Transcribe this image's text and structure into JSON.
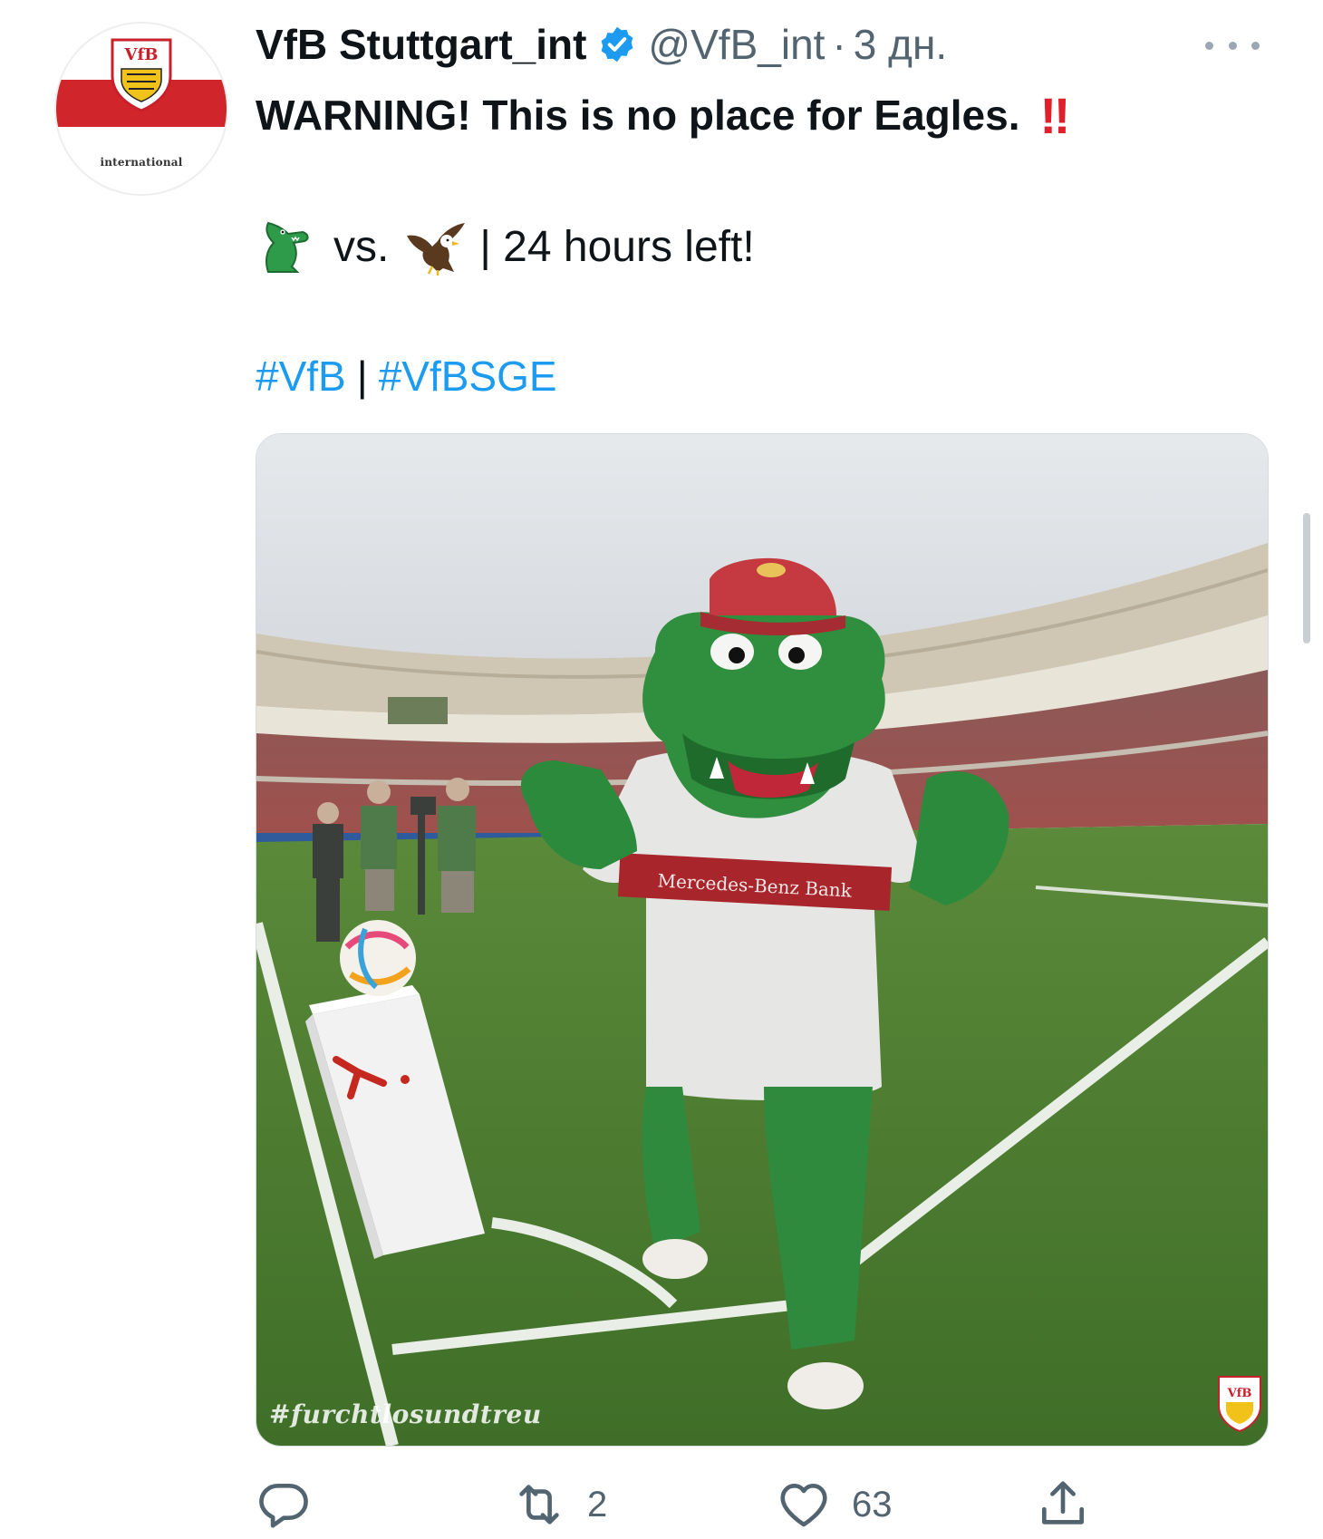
{
  "tweet": {
    "author_name": "VfB Stuttgart_int",
    "handle": "@VfB_int",
    "separator": "·",
    "timestamp": "3 дн.",
    "avatar_caption": "international",
    "line1": "WARNING! This is no place for Eagles.",
    "line1_emoji": "‼",
    "line2_vs": "vs.",
    "line2_rest": "| 24 hours left!",
    "hashtags": [
      "#VfB",
      "#VfBSGE"
    ],
    "hashtag_separator": "|",
    "media": {
      "watermark": "#furchtlosundtreu",
      "shirt_sponsor": "Mercedes-Benz Bank"
    },
    "actions": {
      "reply_count": "",
      "retweet_count": "2",
      "like_count": "63"
    }
  },
  "icons": {
    "verified": "verified-badge-icon",
    "more": "more-options-icon",
    "reply": "reply-icon",
    "retweet": "retweet-icon",
    "like": "heart-icon",
    "share": "share-icon",
    "emoji1": "crocodile-emoji",
    "emoji2": "eagle-emoji"
  },
  "colors": {
    "link": "#1d9bf0",
    "secondary_text": "#536471",
    "brand_red": "#d0262b"
  }
}
